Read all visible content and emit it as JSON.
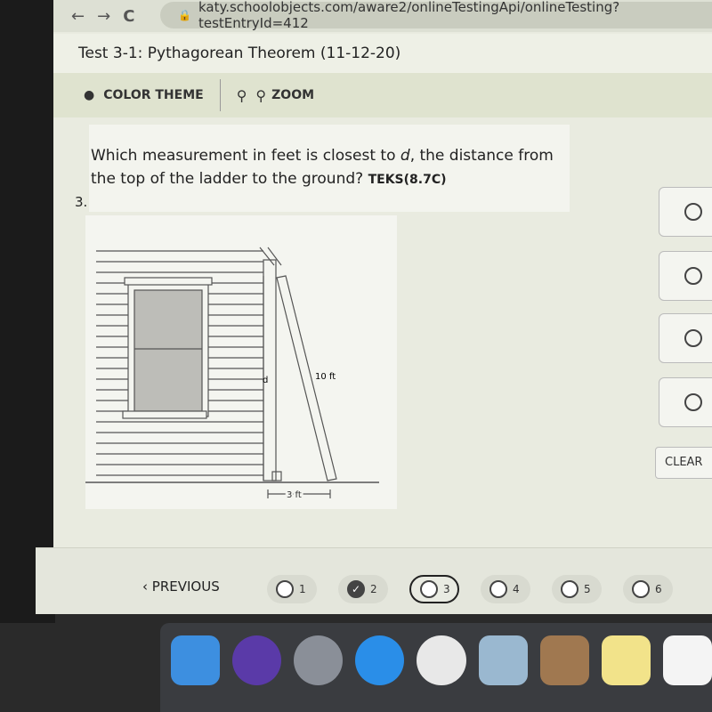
{
  "browser": {
    "url": "katy.schoolobjects.com/aware2/onlineTestingApi/onlineTesting?testEntryId=412"
  },
  "test": {
    "title": "Test 3-1: Pythagorean Theorem (11-12-20)"
  },
  "toolbar": {
    "color_theme": "COLOR THEME",
    "zoom": "ZOOM"
  },
  "question": {
    "number": "3.",
    "text_before": "Which measurement in feet is closest to ",
    "variable": "d",
    "text_after": ", the distance from the top of the ladder to the ground? ",
    "teks": "TEKS(8.7C)",
    "diagram": {
      "d_label": "d",
      "ladder_label": "10 ft",
      "base_label": "3 ft"
    }
  },
  "answers": {
    "count": 4,
    "clear_label": "CLEAR"
  },
  "nav": {
    "previous": "PREVIOUS",
    "questions": [
      {
        "n": "1",
        "state": "unanswered"
      },
      {
        "n": "2",
        "state": "answered"
      },
      {
        "n": "3",
        "state": "current"
      },
      {
        "n": "4",
        "state": "unanswered"
      },
      {
        "n": "5",
        "state": "unanswered"
      },
      {
        "n": "6",
        "state": "unanswered"
      }
    ]
  },
  "dock": {
    "apps": [
      "finder",
      "siri",
      "launchpad",
      "safari",
      "chrome",
      "preview",
      "contacts",
      "notes",
      "reminders"
    ]
  }
}
